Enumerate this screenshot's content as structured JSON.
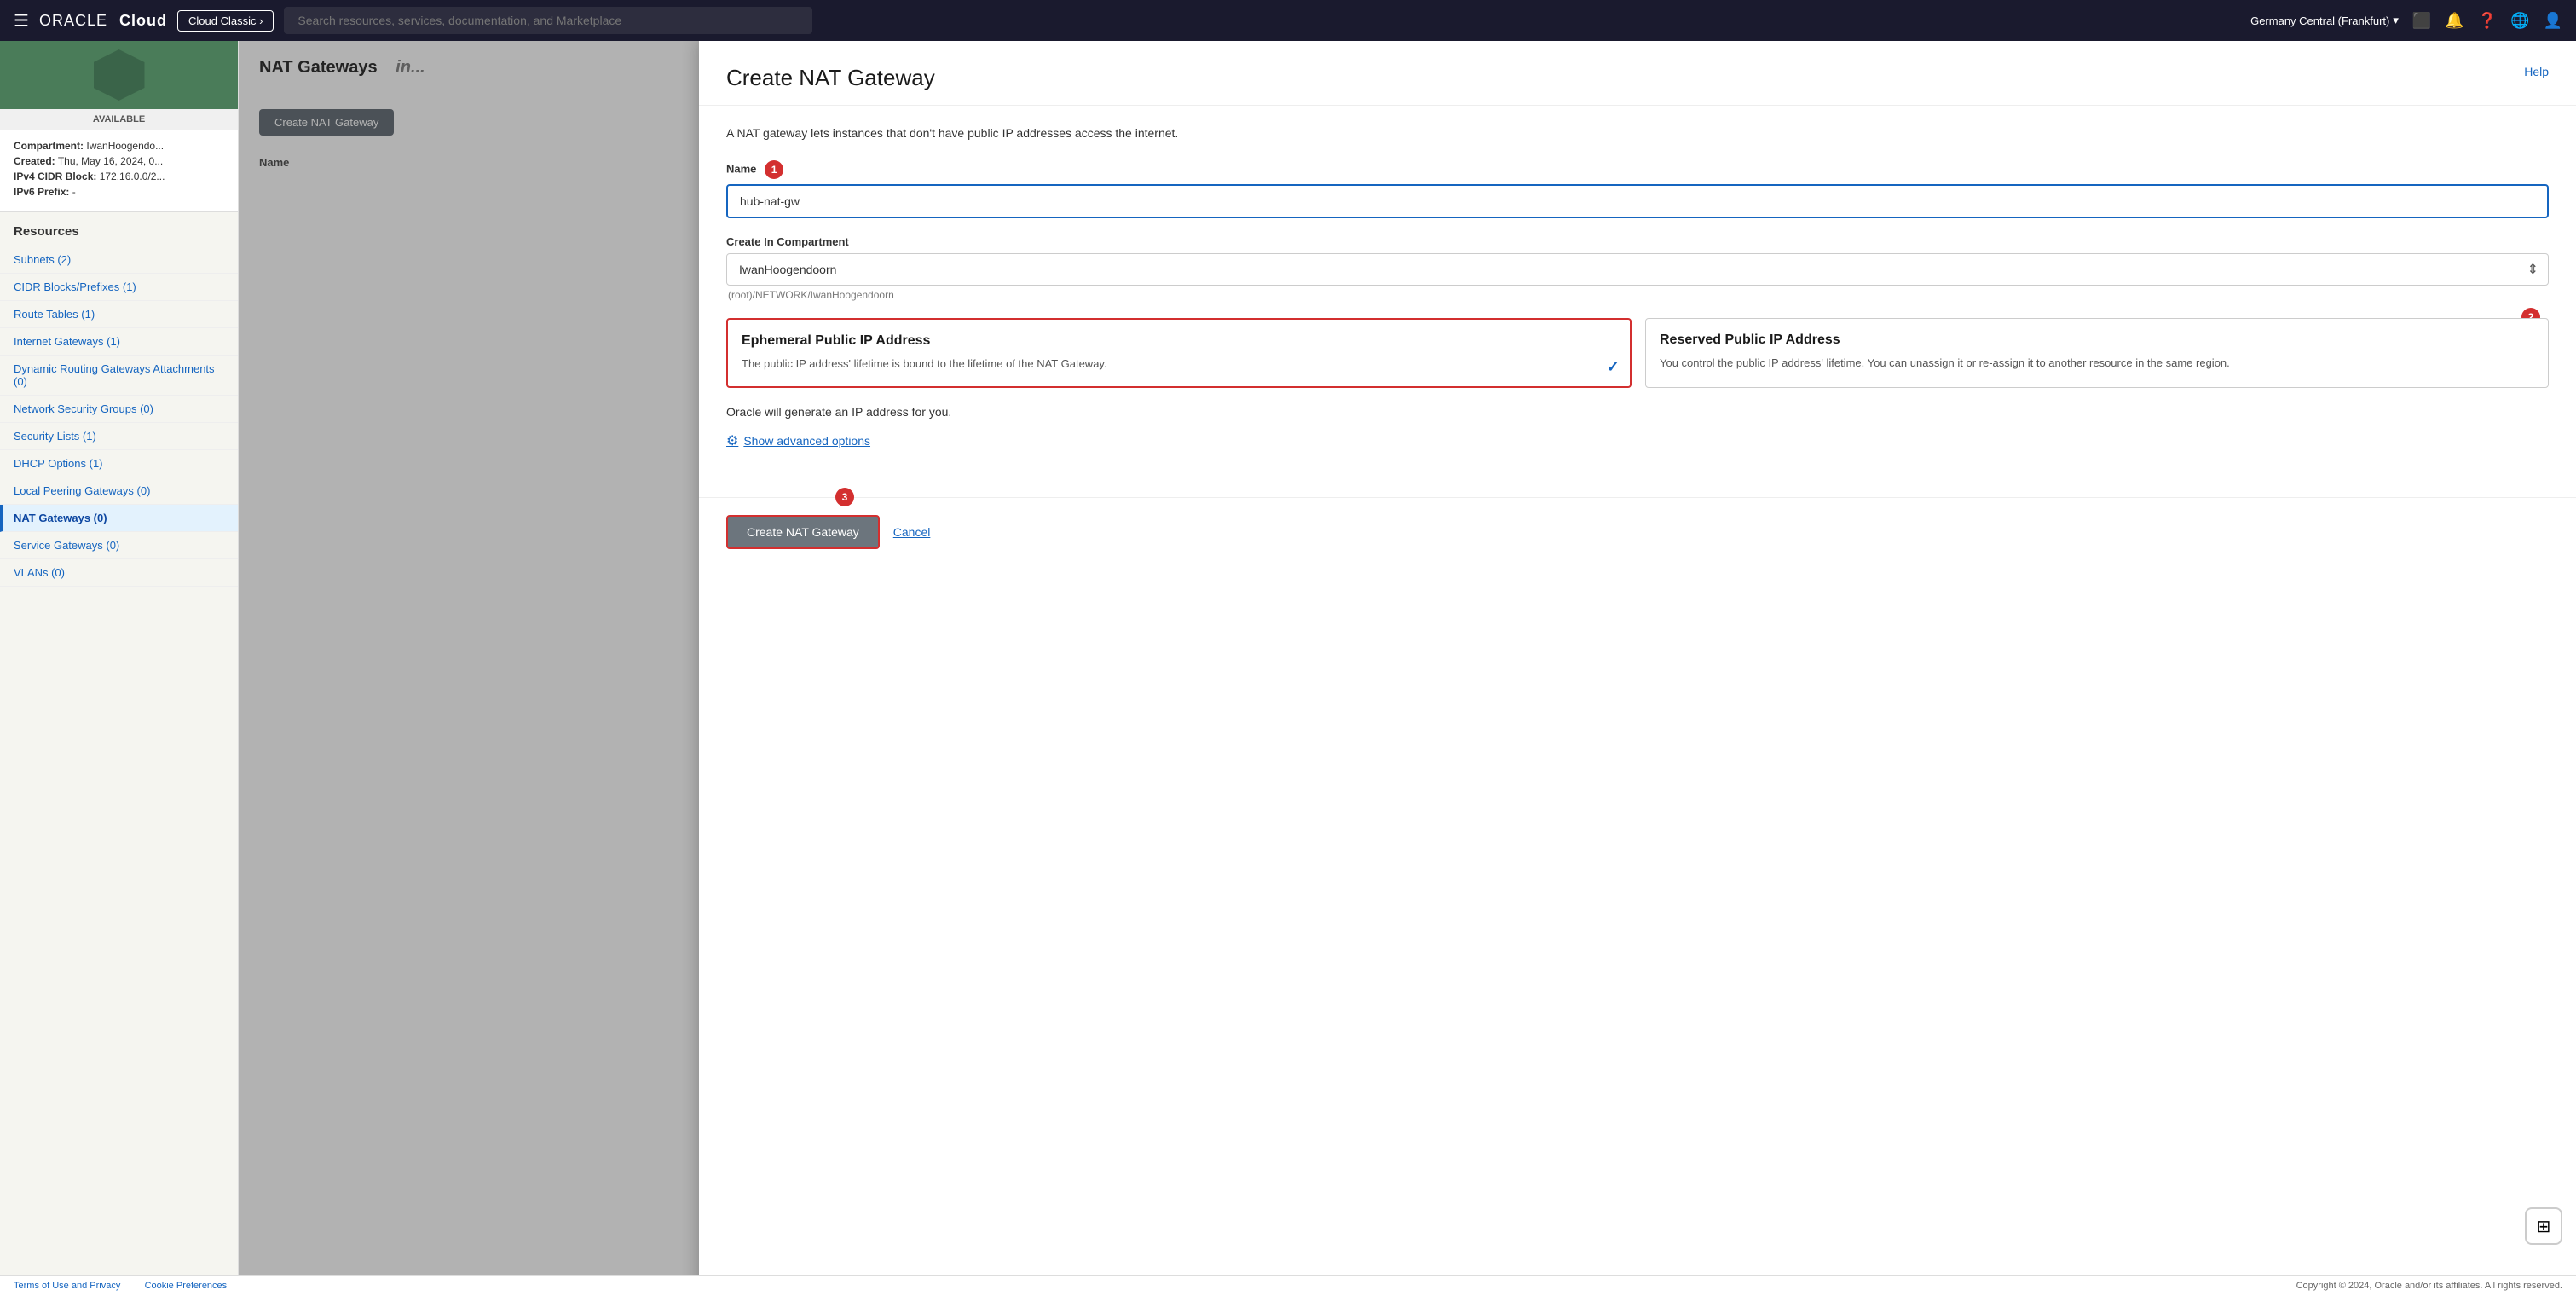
{
  "nav": {
    "hamburger_icon": "☰",
    "logo_oracle": "ORACLE",
    "logo_cloud": "Cloud",
    "cloud_classic_label": "Cloud Classic ›",
    "search_placeholder": "Search resources, services, documentation, and Marketplace",
    "region": "Germany Central (Frankfurt)",
    "region_chevron": "▾",
    "icons": {
      "monitor": "⬛",
      "bell": "🔔",
      "help": "?",
      "globe": "🌐",
      "user": "👤"
    }
  },
  "sidebar": {
    "vcn_status": "AVAILABLE",
    "vcn_info": {
      "compartment_label": "Compartment:",
      "compartment_value": "IwanHoogendo...",
      "created_label": "Created:",
      "created_value": "Thu, May 16, 2024, 0...",
      "ipv4_label": "IPv4 CIDR Block:",
      "ipv4_value": "172.16.0.0/2...",
      "ipv6_label": "IPv6 Prefix:",
      "ipv6_value": "-"
    },
    "resources_title": "Resources",
    "items": [
      {
        "id": "subnets",
        "label": "Subnets (2)"
      },
      {
        "id": "cidr",
        "label": "CIDR Blocks/Prefixes (1)"
      },
      {
        "id": "route-tables",
        "label": "Route Tables (1)"
      },
      {
        "id": "internet-gateways",
        "label": "Internet Gateways (1)"
      },
      {
        "id": "dynamic-routing",
        "label": "Dynamic Routing Gateways Attachments (0)"
      },
      {
        "id": "network-security",
        "label": "Network Security Groups (0)"
      },
      {
        "id": "security-lists",
        "label": "Security Lists (1)"
      },
      {
        "id": "dhcp-options",
        "label": "DHCP Options (1)"
      },
      {
        "id": "local-peering",
        "label": "Local Peering Gateways (0)"
      },
      {
        "id": "nat-gateways",
        "label": "NAT Gateways (0)",
        "active": true
      },
      {
        "id": "service-gateways",
        "label": "Service Gateways (0)"
      },
      {
        "id": "vlans",
        "label": "VLANs (0)"
      }
    ]
  },
  "main": {
    "page_title": "NAT Gateways",
    "page_title_suffix": "in...",
    "create_button": "Create NAT Gateway",
    "table_column_name": "Name"
  },
  "dialog": {
    "title": "Create NAT Gateway",
    "help_link": "Help",
    "description": "A NAT gateway lets instances that don't have public IP addresses access the internet.",
    "name_label": "Name",
    "name_badge": "1",
    "name_value": "hub-nat-gw",
    "compartment_label": "Create In Compartment",
    "compartment_value": "IwanHoogendoorn",
    "compartment_breadcrumb": "(root)/NETWORK/IwanHoogendoorn",
    "ip_badge": "2",
    "ip_options": [
      {
        "id": "ephemeral",
        "title": "Ephemeral Public IP Address",
        "description": "The public IP address' lifetime is bound to the lifetime of the NAT Gateway.",
        "selected": true,
        "check": "✓"
      },
      {
        "id": "reserved",
        "title": "Reserved Public IP Address",
        "description": "You control the public IP address' lifetime. You can unassign it or re-assign it to another resource in the same region.",
        "selected": false
      }
    ],
    "oracle_note": "Oracle will generate an IP address for you.",
    "show_advanced_label": "Show advanced options",
    "footer_badge": "3",
    "create_nat_button": "Create NAT Gateway",
    "cancel_button": "Cancel"
  },
  "footer": {
    "terms": "Terms of Use and Privacy",
    "cookie": "Cookie Preferences",
    "copyright": "Copyright © 2024, Oracle and/or its affiliates. All rights reserved."
  }
}
